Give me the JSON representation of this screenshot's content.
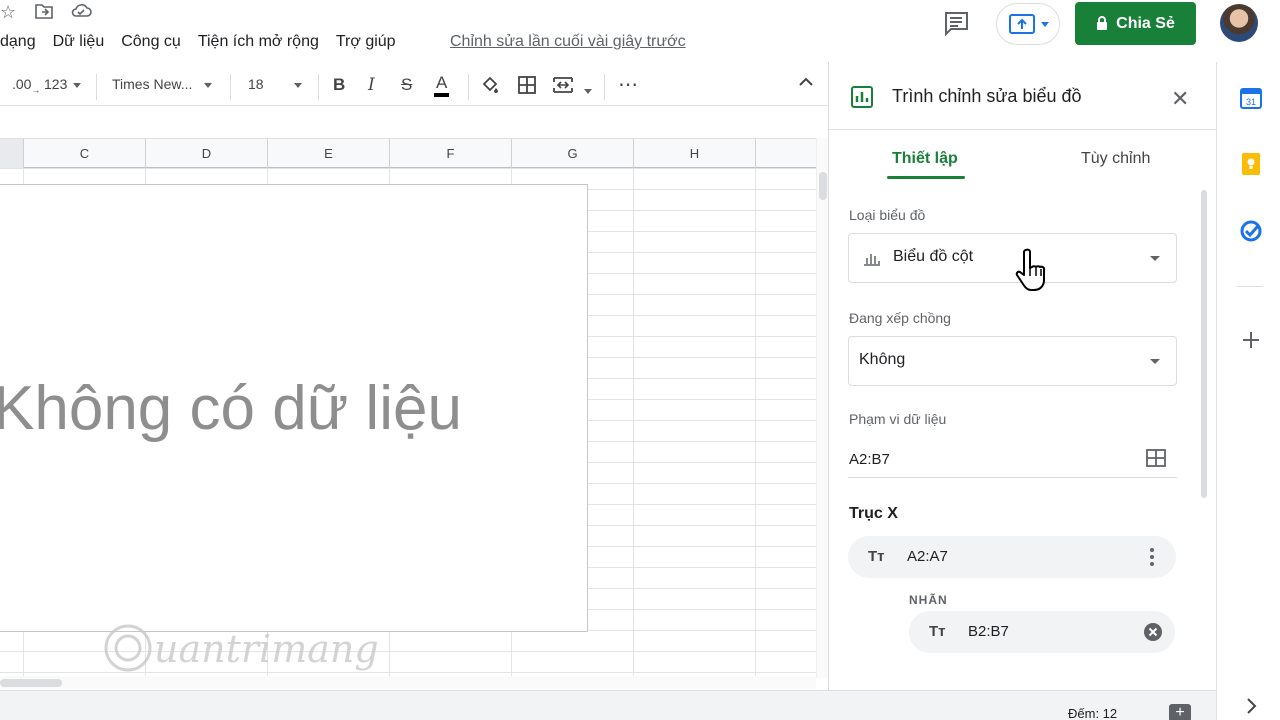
{
  "menu": {
    "items": [
      "dạng",
      "Dữ liệu",
      "Công cụ",
      "Tiện ích mở rộng",
      "Trợ giúp"
    ],
    "last_edit": "Chỉnh sửa lần cuối vài giây trước"
  },
  "header": {
    "share_label": "Chia Sẻ",
    "icons": [
      "star-icon",
      "move-to-folder-icon",
      "cloud-status-icon",
      "comment-icon",
      "present-icon",
      "lock-icon"
    ]
  },
  "toolbar": {
    "decimal_label": ".00",
    "format_label": "123",
    "font_name": "Times New...",
    "font_size": "18",
    "bold": "B",
    "italic": "I",
    "strike": "S",
    "text_color": "A",
    "more": "⋯"
  },
  "columns": [
    "C",
    "D",
    "E",
    "F",
    "G",
    "H"
  ],
  "chart": {
    "empty_text": "Không có dữ liệu",
    "watermark": "Quantrimang"
  },
  "editor": {
    "title": "Trình chỉnh sửa biểu đồ",
    "tabs": [
      "Thiết lập",
      "Tùy chỉnh"
    ],
    "chart_type_label": "Loại biểu đồ",
    "chart_type_value": "Biểu đồ cột",
    "stacking_label": "Đang xếp chồng",
    "stacking_value": "Không",
    "range_label": "Phạm vi dữ liệu",
    "range_value": "A2:B7",
    "x_axis_title": "Trục X",
    "x_axis_range": "A2:A7",
    "label_caption": "NHÃN",
    "label_range": "B2:B7",
    "chip_icon_text": "Tт"
  },
  "status": {
    "count": "Đếm: 12"
  },
  "colors": {
    "accent_green": "#188038",
    "calendar_blue": "#1a73e8",
    "keep_yellow": "#fbbc04",
    "tasks_blue": "#1a73e8"
  }
}
